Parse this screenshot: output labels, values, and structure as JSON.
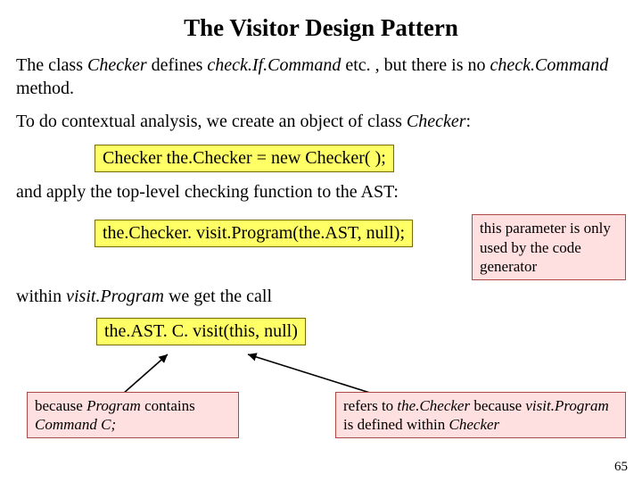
{
  "title": "The Visitor Design Pattern",
  "intro": {
    "t1": "The class ",
    "checker": "Checker",
    "t2": " defines ",
    "checkIf": "check.If.Command",
    "t3": " etc. , but there is no ",
    "checkCmd": "check.Command",
    "t4": " method."
  },
  "line2": {
    "t1": "To do contextual analysis, we create an object of class ",
    "checker": "Checker",
    "t2": ":"
  },
  "code1": "Checker the.Checker = new Checker( );",
  "line3": "and apply the top-level checking function to the AST:",
  "code2": "the.Checker. visit.Program(the.AST, null);",
  "sidebox": "this parameter is only used by the code generator",
  "line4": {
    "t1": "within ",
    "vp": "visit.Program",
    "t2": " we get the call"
  },
  "code3": "the.AST. C. visit(this, null)",
  "anno_left": {
    "t1": "because ",
    "program": "Program",
    "t2": " contains ",
    "cmdC": "Command C;"
  },
  "anno_right": {
    "t1": "refers to ",
    "theChecker": "the.Checker",
    "t2": " because ",
    "vp": "visit.Program",
    "t3": " is defined within ",
    "checker": "Checker"
  },
  "pagenum": "65"
}
